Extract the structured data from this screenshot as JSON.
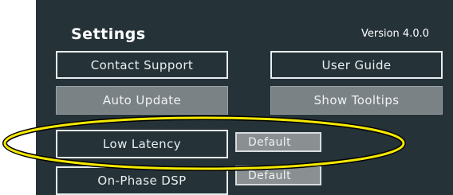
{
  "settings": {
    "title": "Settings",
    "version": "Version 4.0.0"
  },
  "buttons": {
    "contact_support": "Contact Support",
    "user_guide": "User Guide",
    "auto_update": "Auto Update",
    "show_tooltips": "Show Tooltips",
    "low_latency": "Low Latency",
    "low_latency_default": "Default",
    "on_phase_dsp": "On-Phase DSP",
    "on_phase_dsp_default": "Default"
  },
  "colors": {
    "panel_bg": "#253339",
    "highlight_outline": "#f5e800"
  }
}
